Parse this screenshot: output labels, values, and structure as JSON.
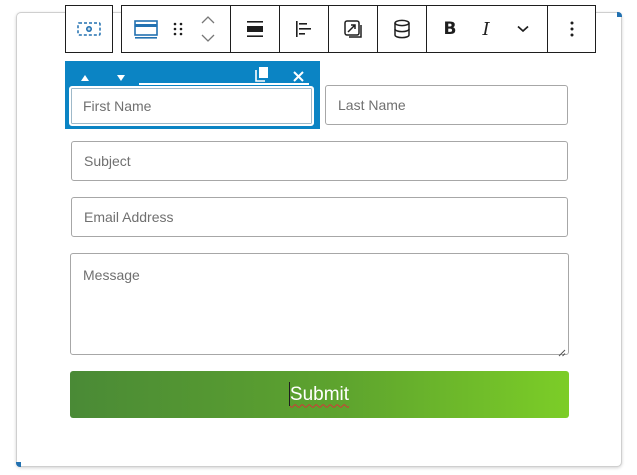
{
  "form": {
    "first_name_placeholder": "First Name",
    "last_name_placeholder": "Last Name",
    "subject_placeholder": "Subject",
    "email_placeholder": "Email Address",
    "message_placeholder": "Message",
    "submit_label": "Submit"
  },
  "toolbar": {
    "icons": [
      "form-block-icon",
      "layout-icon",
      "drag-handle-icon",
      "move-up-icon",
      "move-down-icon",
      "align-full-icon",
      "justify-left-icon",
      "link-box-icon",
      "database-icon",
      "bold-icon",
      "italic-icon",
      "chevron-down-icon",
      "more-options-icon"
    ],
    "bold_label": "B",
    "italic_label": "I"
  },
  "mover_bar": {
    "icons": [
      "arrow-up-icon",
      "arrow-down-icon",
      "duplicate-icon",
      "close-icon"
    ]
  },
  "colors": {
    "accent": "#0b84c4",
    "submit_gradient_start": "#4a8a36",
    "submit_gradient_end": "#7ccd27",
    "spellcheck": "#d63638"
  }
}
